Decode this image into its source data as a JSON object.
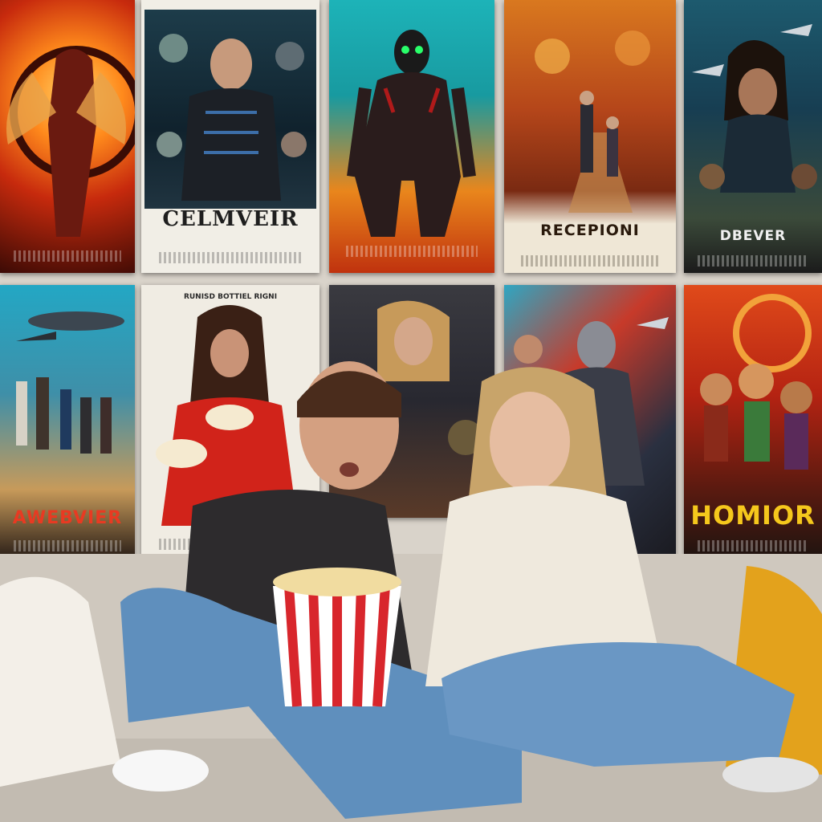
{
  "scene": {
    "description_colors": {
      "wall": "#d9d3ca",
      "sofa": "#cfc8be",
      "popcorn_red": "#d8262c",
      "pillow_yellow": "#e3a21c",
      "sweater": "#efe9dd",
      "tshirt": "#2d2b2d",
      "jeans": "#5f8fbd"
    }
  },
  "posters": {
    "top": [
      {
        "name": "poster-top-1",
        "title": "",
        "topline": ""
      },
      {
        "name": "poster-top-2",
        "title": "CELMVEIR",
        "topline": ""
      },
      {
        "name": "poster-top-3",
        "title": "",
        "topline": ""
      },
      {
        "name": "poster-top-4",
        "title": "RECEPIONI",
        "topline": ""
      },
      {
        "name": "poster-top-5",
        "title": "DBEVER",
        "topline": ""
      }
    ],
    "bottom": [
      {
        "name": "poster-bottom-1",
        "title": "AWEBVIER",
        "topline": ""
      },
      {
        "name": "poster-bottom-2",
        "title": "",
        "topline": "RUNISD BOTTIEL RIGNI"
      },
      {
        "name": "poster-bottom-3",
        "title": "",
        "topline": ""
      },
      {
        "name": "poster-bottom-4",
        "title": "",
        "topline": ""
      },
      {
        "name": "poster-bottom-5",
        "title": "HOMIOR",
        "topline": ""
      }
    ]
  }
}
